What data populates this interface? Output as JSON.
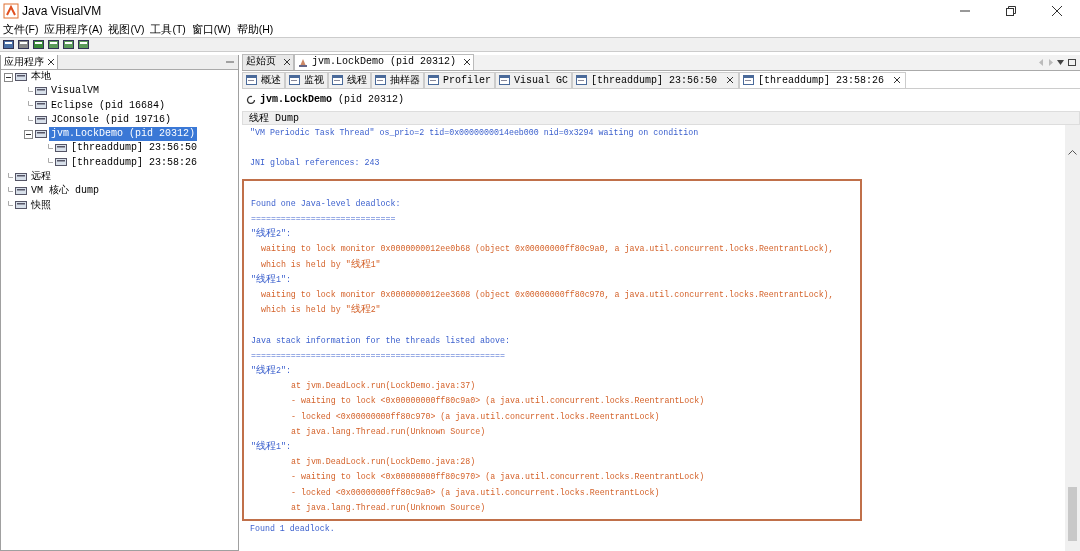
{
  "window": {
    "title": "Java VisualVM"
  },
  "menu": [
    "文件(F)",
    "应用程序(A)",
    "视图(V)",
    "工具(T)",
    "窗口(W)",
    "帮助(H)"
  ],
  "sidebar": {
    "tab": "应用程序",
    "items": [
      {
        "label": "本地",
        "expanded": true,
        "selected": false,
        "children": [
          {
            "label": "VisualVM",
            "selected": false
          },
          {
            "label": "Eclipse (pid 16684)",
            "selected": false
          },
          {
            "label": "JConsole (pid 19716)",
            "selected": false
          },
          {
            "label": "jvm.LockDemo (pid 20312)",
            "expanded": true,
            "selected": true,
            "children": [
              {
                "label": "[threaddump] 23:56:50",
                "selected": false
              },
              {
                "label": "[threaddump] 23:58:26",
                "selected": false
              }
            ]
          }
        ]
      },
      {
        "label": "远程",
        "selected": false
      },
      {
        "label": "VM 核心 dump",
        "selected": false
      },
      {
        "label": "快照",
        "selected": false
      }
    ]
  },
  "editor_tabs": [
    {
      "label": "起始页",
      "selected": false
    },
    {
      "label": "jvm.LockDemo (pid 20312)",
      "selected": true
    }
  ],
  "view_tabs": [
    {
      "label": "概述",
      "closable": false,
      "selected": false
    },
    {
      "label": "监视",
      "closable": false,
      "selected": false
    },
    {
      "label": "线程",
      "closable": false,
      "selected": false
    },
    {
      "label": "抽样器",
      "closable": false,
      "selected": false
    },
    {
      "label": "Profiler",
      "closable": false,
      "selected": false
    },
    {
      "label": "Visual GC",
      "closable": false,
      "selected": false
    },
    {
      "label": "[threaddump] 23:56:50",
      "closable": true,
      "selected": false
    },
    {
      "label": "[threaddump] 23:58:26",
      "closable": true,
      "selected": true
    }
  ],
  "view_title": "**jvm.LockDemo** (pid 20312)",
  "section_header": "线程 Dump",
  "dump": {
    "before": [
      {
        "kind": "header",
        "text": "\"VM Periodic Task Thread\" os_prio=2 tid=0x0000000014eeb000 nid=0x3294 waiting on condition"
      },
      {
        "kind": "header",
        "text": "JNI global references: 243",
        "space_before": true
      }
    ],
    "highlighted": [
      {
        "kind": "header",
        "text": "Found one Java-level deadlock:",
        "space_before": true
      },
      {
        "kind": "header",
        "text": "============================="
      },
      {
        "kind": "header",
        "text": "\"线程2\":"
      },
      {
        "kind": "detail",
        "text": "waiting to lock monitor 0x0000000012ee0b68 (object 0x00000000ff80c9a0, a java.util.concurrent.locks.ReentrantLock),"
      },
      {
        "kind": "detail",
        "text": "which is held by \"线程1\""
      },
      {
        "kind": "header",
        "text": "\"线程1\":"
      },
      {
        "kind": "detail",
        "text": "waiting to lock monitor 0x0000000012ee3608 (object 0x00000000ff80c970, a java.util.concurrent.locks.ReentrantLock),"
      },
      {
        "kind": "detail",
        "text": "which is held by \"线程2\""
      },
      {
        "kind": "header",
        "text": "Java stack information for the threads listed above:",
        "space_before": true
      },
      {
        "kind": "header",
        "text": "==================================================="
      },
      {
        "kind": "header",
        "text": "\"线程2\":"
      },
      {
        "kind": "frame",
        "text": "at jvm.DeadLock.run(LockDemo.java:37)"
      },
      {
        "kind": "frame",
        "text": "- waiting to lock <0x00000000ff80c9a0> (a java.util.concurrent.locks.ReentrantLock)"
      },
      {
        "kind": "frame",
        "text": "- locked <0x00000000ff80c970> (a java.util.concurrent.locks.ReentrantLock)"
      },
      {
        "kind": "frame",
        "text": "at java.lang.Thread.run(Unknown Source)"
      },
      {
        "kind": "header",
        "text": "\"线程1\":"
      },
      {
        "kind": "frame",
        "text": "at jvm.DeadLock.run(LockDemo.java:28)"
      },
      {
        "kind": "frame",
        "text": "- waiting to lock <0x00000000ff80c970> (a java.util.concurrent.locks.ReentrantLock)"
      },
      {
        "kind": "frame",
        "text": "- locked <0x00000000ff80c9a0> (a java.util.concurrent.locks.ReentrantLock)"
      },
      {
        "kind": "frame",
        "text": "at java.lang.Thread.run(Unknown Source)"
      }
    ],
    "after": [
      {
        "kind": "header",
        "text": "Found 1 deadlock."
      }
    ]
  }
}
